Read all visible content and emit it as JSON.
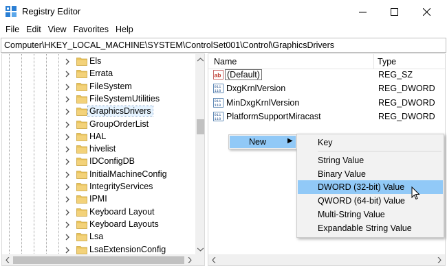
{
  "window": {
    "title": "Registry Editor"
  },
  "menubar": {
    "items": [
      "File",
      "Edit",
      "View",
      "Favorites",
      "Help"
    ]
  },
  "address": {
    "path": "Computer\\HKEY_LOCAL_MACHINE\\SYSTEM\\ControlSet001\\Control\\GraphicsDrivers"
  },
  "tree": {
    "items": [
      {
        "label": "Els",
        "selected": false
      },
      {
        "label": "Errata",
        "selected": false
      },
      {
        "label": "FileSystem",
        "selected": false
      },
      {
        "label": "FileSystemUtilities",
        "selected": false
      },
      {
        "label": "GraphicsDrivers",
        "selected": true
      },
      {
        "label": "GroupOrderList",
        "selected": false
      },
      {
        "label": "HAL",
        "selected": false
      },
      {
        "label": "hivelist",
        "selected": false
      },
      {
        "label": "IDConfigDB",
        "selected": false
      },
      {
        "label": "InitialMachineConfig",
        "selected": false
      },
      {
        "label": "IntegrityServices",
        "selected": false
      },
      {
        "label": "IPMI",
        "selected": false
      },
      {
        "label": "Keyboard Layout",
        "selected": false
      },
      {
        "label": "Keyboard Layouts",
        "selected": false
      },
      {
        "label": "Lsa",
        "selected": false
      },
      {
        "label": "LsaExtensionConfig",
        "selected": false
      }
    ]
  },
  "list": {
    "headers": {
      "name": "Name",
      "type": "Type"
    },
    "rows": [
      {
        "name": "(Default)",
        "type": "REG_SZ",
        "icon": "string-value-icon"
      },
      {
        "name": "DxgKrnlVersion",
        "type": "REG_DWORD",
        "icon": "dword-value-icon"
      },
      {
        "name": "MinDxgKrnlVersion",
        "type": "REG_DWORD",
        "icon": "dword-value-icon"
      },
      {
        "name": "PlatformSupportMiracast",
        "type": "REG_DWORD",
        "icon": "dword-value-icon"
      }
    ]
  },
  "context_menu": {
    "new_label": "New"
  },
  "submenu": {
    "items": [
      "Key",
      "String Value",
      "Binary Value",
      "DWORD (32-bit) Value",
      "QWORD (64-bit) Value",
      "Multi-String Value",
      "Expandable String Value"
    ],
    "hovered": "DWORD (32-bit) Value"
  },
  "colors": {
    "highlight": "#91c9f7",
    "menu_bg": "#f2f2f2",
    "folder": "#e8c35a"
  }
}
